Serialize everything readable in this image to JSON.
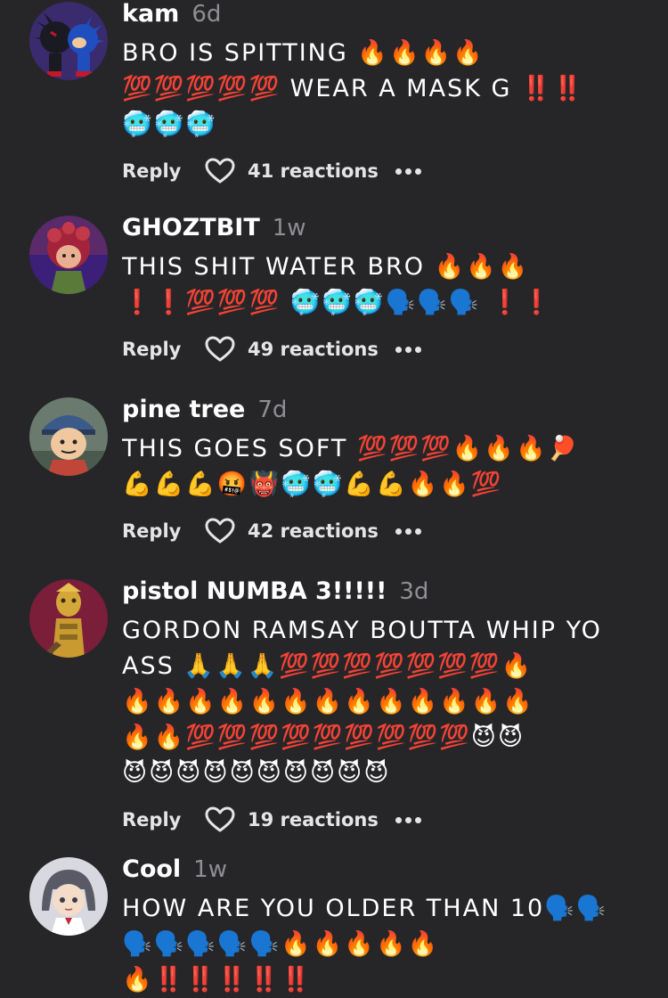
{
  "comments": [
    {
      "username": "kam",
      "time": "6d",
      "text_lines": [
        "BRO IS SPITTING 🔥🔥🔥🔥",
        "💯💯💯💯💯 WEAR A MASK G ‼️‼️",
        "🥶🥶🥶"
      ],
      "reply_label": "Reply",
      "reactions": "41 reactions"
    },
    {
      "username": "GHOZTBIT",
      "time": "1w",
      "text_lines": [
        "THIS SHIT WATER BRO 🔥🔥🔥",
        "❗❗💯💯💯 🥶🥶🥶🗣️🗣️🗣️ ❗❗"
      ],
      "reply_label": "Reply",
      "reactions": "49 reactions"
    },
    {
      "username": "pine tree",
      "time": "7d",
      "text_lines": [
        "THIS GOES SOFT 💯💯💯🔥🔥🔥🏓",
        "💪💪💪🤬👹🥶🥶💪💪🔥🔥💯"
      ],
      "reply_label": "Reply",
      "reactions": "42 reactions"
    },
    {
      "username": "pistol NUMBA 3!!!!!",
      "time": "3d",
      "text_lines": [
        "GORDON RAMSAY BOUTTA WHIP YO",
        "ASS 🙏🙏🙏💯💯💯💯💯💯💯🔥",
        "🔥🔥🔥🔥🔥🔥🔥🔥🔥🔥🔥🔥🔥",
        "🔥🔥💯💯💯💯💯💯💯💯💯😈😈",
        "😈😈😈😈😈😈😈😈😈😈"
      ],
      "reply_label": "Reply",
      "reactions": "19 reactions"
    },
    {
      "username": "Cool",
      "time": "1w",
      "text_lines": [
        "HOW ARE YOU OLDER THAN 10🗣️🗣️",
        "🗣️🗣️🗣️🗣️🗣️🔥🔥🔥🔥🔥",
        "🔥‼️‼️‼️‼️‼️"
      ]
    }
  ],
  "avatars": [
    {
      "icon": "sonic-shadow-avatar",
      "bg": "#3a2a6e"
    },
    {
      "icon": "red-hair-character-avatar",
      "bg": "#5a2a6a"
    },
    {
      "icon": "cartoon-boy-avatar",
      "bg": "#6b7a6e"
    },
    {
      "icon": "gold-jojo-stand-avatar",
      "bg": "#7a1e3a"
    },
    {
      "icon": "anime-girl-avatar",
      "bg": "#c8c8d0"
    }
  ]
}
